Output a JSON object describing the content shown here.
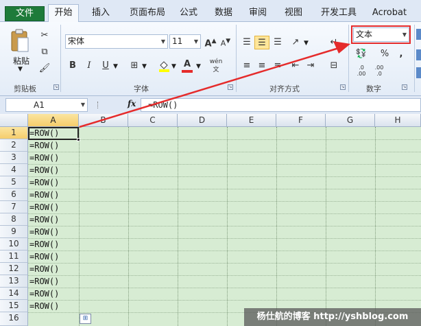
{
  "tabs": [
    "文件",
    "开始",
    "插入",
    "页面布局",
    "公式",
    "数据",
    "审阅",
    "视图",
    "开发工具",
    "Acrobat"
  ],
  "ribbon": {
    "clipboard": {
      "paste_label": "粘贴",
      "group_label": "剪贴板"
    },
    "font": {
      "name": "宋体",
      "size": "11",
      "group_label": "字体",
      "grow": "A",
      "shrink": "A",
      "bold": "B",
      "italic": "I",
      "underline": "U",
      "font_color_letter": "A",
      "phonetic": "wén"
    },
    "alignment": {
      "group_label": "对齐方式"
    },
    "number": {
      "format": "文本",
      "group_label": "数字",
      "percent": "%",
      "comma": ",",
      "inc_decimals": ".0 .00",
      "dec_decimals": ".00 .0"
    }
  },
  "formula_bar": {
    "name_box": "A1",
    "fx": "fx",
    "formula": "=ROW()"
  },
  "grid": {
    "columns": [
      "A",
      "B",
      "C",
      "D",
      "E",
      "F",
      "G",
      "H"
    ],
    "rows": [
      "1",
      "2",
      "3",
      "4",
      "5",
      "6",
      "7",
      "8",
      "9",
      "10",
      "11",
      "12",
      "13",
      "14",
      "15",
      "16"
    ],
    "column_a_values": [
      "=ROW()",
      "=ROW()",
      "=ROW()",
      "=ROW()",
      "=ROW()",
      "=ROW()",
      "=ROW()",
      "=ROW()",
      "=ROW()",
      "=ROW()",
      "=ROW()",
      "=ROW()",
      "=ROW()",
      "=ROW()",
      "=ROW()"
    ]
  },
  "watermark": "杨仕航的博客 http://yshblog.com",
  "colors": {
    "file_tab": "#1e7b3a",
    "sheet_bg": "#d7ecd3",
    "highlight": "#e52b2b",
    "selected_header": "#f5cd6c"
  }
}
